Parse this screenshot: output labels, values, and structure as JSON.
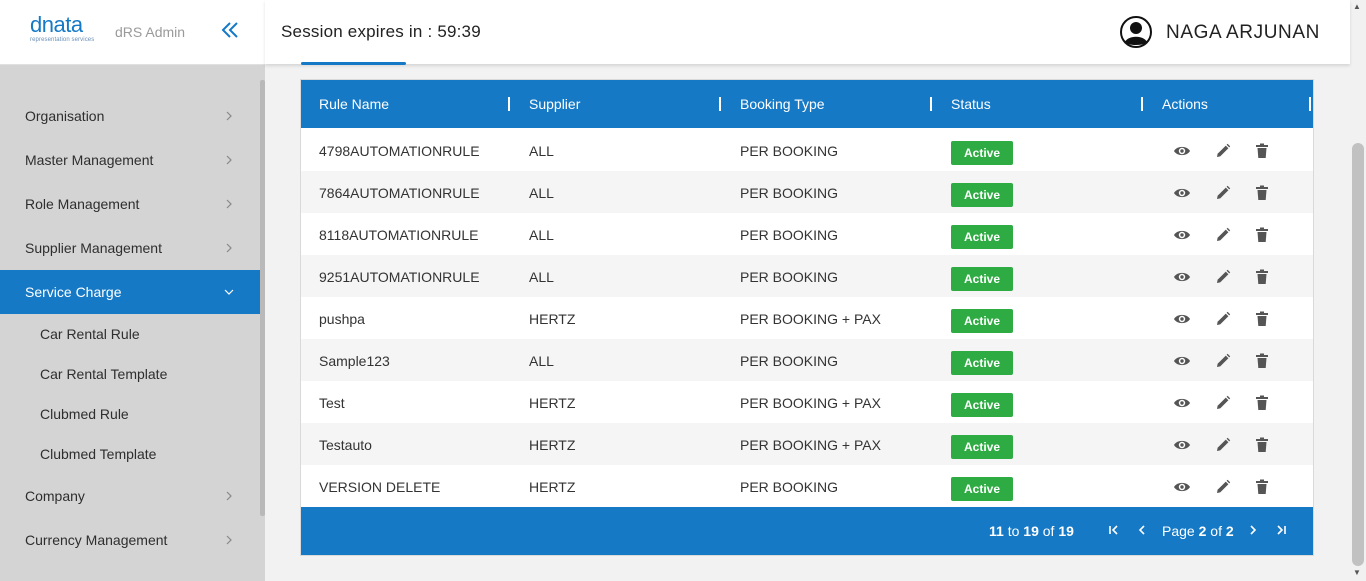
{
  "brand": {
    "logo_text": "dnata",
    "logo_sub": "representation services",
    "app_name": "dRS Admin"
  },
  "header": {
    "session_label": "Session expires in : 59:39",
    "user_name": "NAGA ARJUNAN"
  },
  "sidebar": {
    "items": [
      {
        "label": "Organisation"
      },
      {
        "label": "Master Management"
      },
      {
        "label": "Role Management"
      },
      {
        "label": "Supplier Management"
      },
      {
        "label": "Service Charge",
        "active": true,
        "children": [
          {
            "label": "Car Rental Rule"
          },
          {
            "label": "Car Rental Template"
          },
          {
            "label": "Clubmed Rule"
          },
          {
            "label": "Clubmed Template"
          }
        ]
      },
      {
        "label": "Company"
      },
      {
        "label": "Currency Management"
      }
    ]
  },
  "table": {
    "columns": [
      "Rule Name",
      "Supplier",
      "Booking Type",
      "Status",
      "Actions"
    ],
    "rows": [
      {
        "rule_name": "4798AUTOMATIONRULE",
        "supplier": "ALL",
        "booking_type": "PER BOOKING",
        "status": "Active"
      },
      {
        "rule_name": "7864AUTOMATIONRULE",
        "supplier": "ALL",
        "booking_type": "PER BOOKING",
        "status": "Active"
      },
      {
        "rule_name": "8118AUTOMATIONRULE",
        "supplier": "ALL",
        "booking_type": "PER BOOKING",
        "status": "Active"
      },
      {
        "rule_name": "9251AUTOMATIONRULE",
        "supplier": "ALL",
        "booking_type": "PER BOOKING",
        "status": "Active"
      },
      {
        "rule_name": "pushpa",
        "supplier": "HERTZ",
        "booking_type": "PER BOOKING + PAX",
        "status": "Active"
      },
      {
        "rule_name": "Sample123",
        "supplier": "ALL",
        "booking_type": "PER BOOKING",
        "status": "Active"
      },
      {
        "rule_name": "Test",
        "supplier": "HERTZ",
        "booking_type": "PER BOOKING + PAX",
        "status": "Active"
      },
      {
        "rule_name": "Testauto",
        "supplier": "HERTZ",
        "booking_type": "PER BOOKING + PAX",
        "status": "Active"
      },
      {
        "rule_name": "VERSION DELETE",
        "supplier": "HERTZ",
        "booking_type": "PER BOOKING",
        "status": "Active"
      }
    ],
    "action_icons": [
      "view-icon",
      "edit-icon",
      "delete-icon"
    ]
  },
  "pagination": {
    "range_from": "11",
    "range_to_word": "to",
    "range_to": "19",
    "range_of_word": "of",
    "range_total": "19",
    "page_word": "Page",
    "page_current": "2",
    "page_of_word": "of",
    "page_total": "2"
  },
  "colors": {
    "accent": "#1579c6",
    "active_badge": "#2eab42",
    "sidebar_bg": "#d4d4d4"
  }
}
